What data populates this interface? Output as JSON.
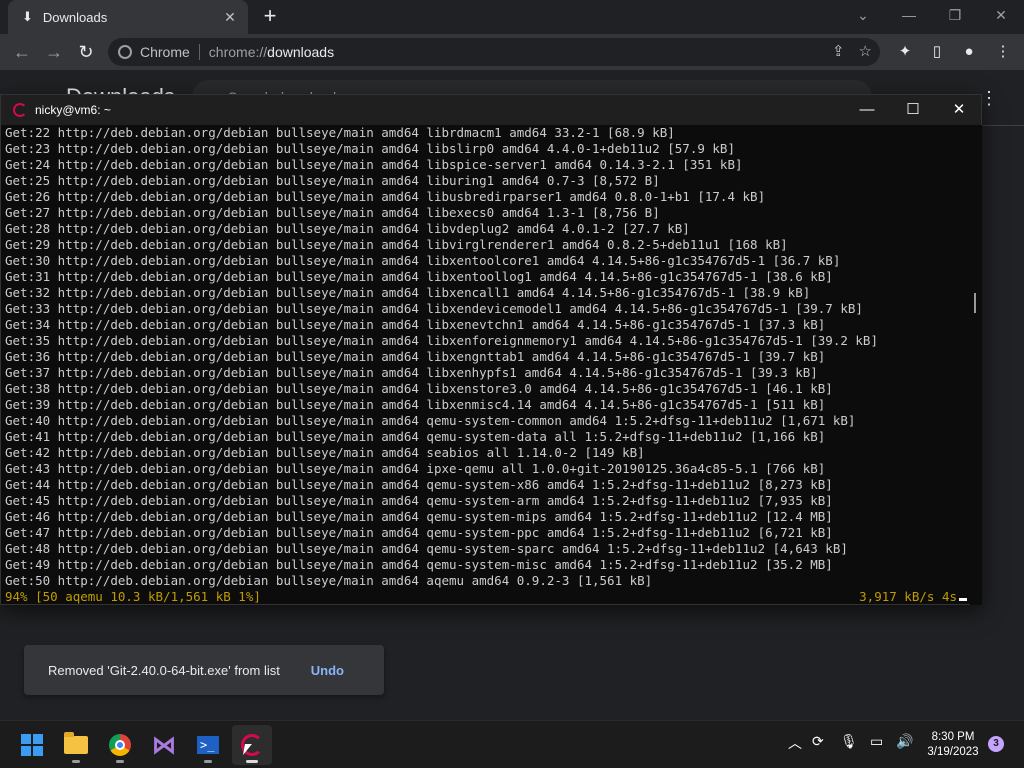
{
  "chrome": {
    "tab": {
      "title": "Downloads",
      "icon": "download-icon"
    },
    "omnibox": {
      "site": "Chrome",
      "scheme": "chrome://",
      "path": "downloads"
    },
    "page": {
      "title": "Downloads",
      "search_placeholder": "Search downloads"
    },
    "toast": {
      "message": "Removed 'Git-2.40.0-64-bit.exe' from list",
      "undo_label": "Undo"
    }
  },
  "terminal": {
    "title": "nicky@vm6: ~",
    "lines": [
      "Get:22 http://deb.debian.org/debian bullseye/main amd64 librdmacm1 amd64 33.2-1 [68.9 kB]",
      "Get:23 http://deb.debian.org/debian bullseye/main amd64 libslirp0 amd64 4.4.0-1+deb11u2 [57.9 kB]",
      "Get:24 http://deb.debian.org/debian bullseye/main amd64 libspice-server1 amd64 0.14.3-2.1 [351 kB]",
      "Get:25 http://deb.debian.org/debian bullseye/main amd64 liburing1 amd64 0.7-3 [8,572 B]",
      "Get:26 http://deb.debian.org/debian bullseye/main amd64 libusbredirparser1 amd64 0.8.0-1+b1 [17.4 kB]",
      "Get:27 http://deb.debian.org/debian bullseye/main amd64 libexecs0 amd64 1.3-1 [8,756 B]",
      "Get:28 http://deb.debian.org/debian bullseye/main amd64 libvdeplug2 amd64 4.0.1-2 [27.7 kB]",
      "Get:29 http://deb.debian.org/debian bullseye/main amd64 libvirglrenderer1 amd64 0.8.2-5+deb11u1 [168 kB]",
      "Get:30 http://deb.debian.org/debian bullseye/main amd64 libxentoolcore1 amd64 4.14.5+86-g1c354767d5-1 [36.7 kB]",
      "Get:31 http://deb.debian.org/debian bullseye/main amd64 libxentoollog1 amd64 4.14.5+86-g1c354767d5-1 [38.6 kB]",
      "Get:32 http://deb.debian.org/debian bullseye/main amd64 libxencall1 amd64 4.14.5+86-g1c354767d5-1 [38.9 kB]",
      "Get:33 http://deb.debian.org/debian bullseye/main amd64 libxendevicemodel1 amd64 4.14.5+86-g1c354767d5-1 [39.7 kB]",
      "Get:34 http://deb.debian.org/debian bullseye/main amd64 libxenevtchn1 amd64 4.14.5+86-g1c354767d5-1 [37.3 kB]",
      "Get:35 http://deb.debian.org/debian bullseye/main amd64 libxenforeignmemory1 amd64 4.14.5+86-g1c354767d5-1 [39.2 kB]",
      "Get:36 http://deb.debian.org/debian bullseye/main amd64 libxengnttab1 amd64 4.14.5+86-g1c354767d5-1 [39.7 kB]",
      "Get:37 http://deb.debian.org/debian bullseye/main amd64 libxenhypfs1 amd64 4.14.5+86-g1c354767d5-1 [39.3 kB]",
      "Get:38 http://deb.debian.org/debian bullseye/main amd64 libxenstore3.0 amd64 4.14.5+86-g1c354767d5-1 [46.1 kB]",
      "Get:39 http://deb.debian.org/debian bullseye/main amd64 libxenmisc4.14 amd64 4.14.5+86-g1c354767d5-1 [511 kB]",
      "Get:40 http://deb.debian.org/debian bullseye/main amd64 qemu-system-common amd64 1:5.2+dfsg-11+deb11u2 [1,671 kB]",
      "Get:41 http://deb.debian.org/debian bullseye/main amd64 qemu-system-data all 1:5.2+dfsg-11+deb11u2 [1,166 kB]",
      "Get:42 http://deb.debian.org/debian bullseye/main amd64 seabios all 1.14.0-2 [149 kB]",
      "Get:43 http://deb.debian.org/debian bullseye/main amd64 ipxe-qemu all 1.0.0+git-20190125.36a4c85-5.1 [766 kB]",
      "Get:44 http://deb.debian.org/debian bullseye/main amd64 qemu-system-x86 amd64 1:5.2+dfsg-11+deb11u2 [8,273 kB]",
      "Get:45 http://deb.debian.org/debian bullseye/main amd64 qemu-system-arm amd64 1:5.2+dfsg-11+deb11u2 [7,935 kB]",
      "Get:46 http://deb.debian.org/debian bullseye/main amd64 qemu-system-mips amd64 1:5.2+dfsg-11+deb11u2 [12.4 MB]",
      "Get:47 http://deb.debian.org/debian bullseye/main amd64 qemu-system-ppc amd64 1:5.2+dfsg-11+deb11u2 [6,721 kB]",
      "Get:48 http://deb.debian.org/debian bullseye/main amd64 qemu-system-sparc amd64 1:5.2+dfsg-11+deb11u2 [4,643 kB]",
      "Get:49 http://deb.debian.org/debian bullseye/main amd64 qemu-system-misc amd64 1:5.2+dfsg-11+deb11u2 [35.2 MB]",
      "Get:50 http://deb.debian.org/debian bullseye/main amd64 aqemu amd64 0.9.2-3 [1,561 kB]"
    ],
    "status_left": "94% [50 aqemu 10.3 kB/1,561 kB 1%]",
    "status_right": "3,917 kB/s 4s"
  },
  "taskbar": {
    "apps": [
      {
        "name": "start-button",
        "icon": "windows-icon"
      },
      {
        "name": "file-explorer",
        "icon": "folder-icon"
      },
      {
        "name": "chrome",
        "icon": "chrome-icon"
      },
      {
        "name": "visual-studio",
        "icon": "visual-studio-icon"
      },
      {
        "name": "powershell",
        "icon": "powershell-icon"
      },
      {
        "name": "debian-terminal",
        "icon": "debian-icon"
      }
    ],
    "clock": {
      "time": "8:30 PM",
      "date": "3/19/2023"
    },
    "notification_count": "3"
  }
}
